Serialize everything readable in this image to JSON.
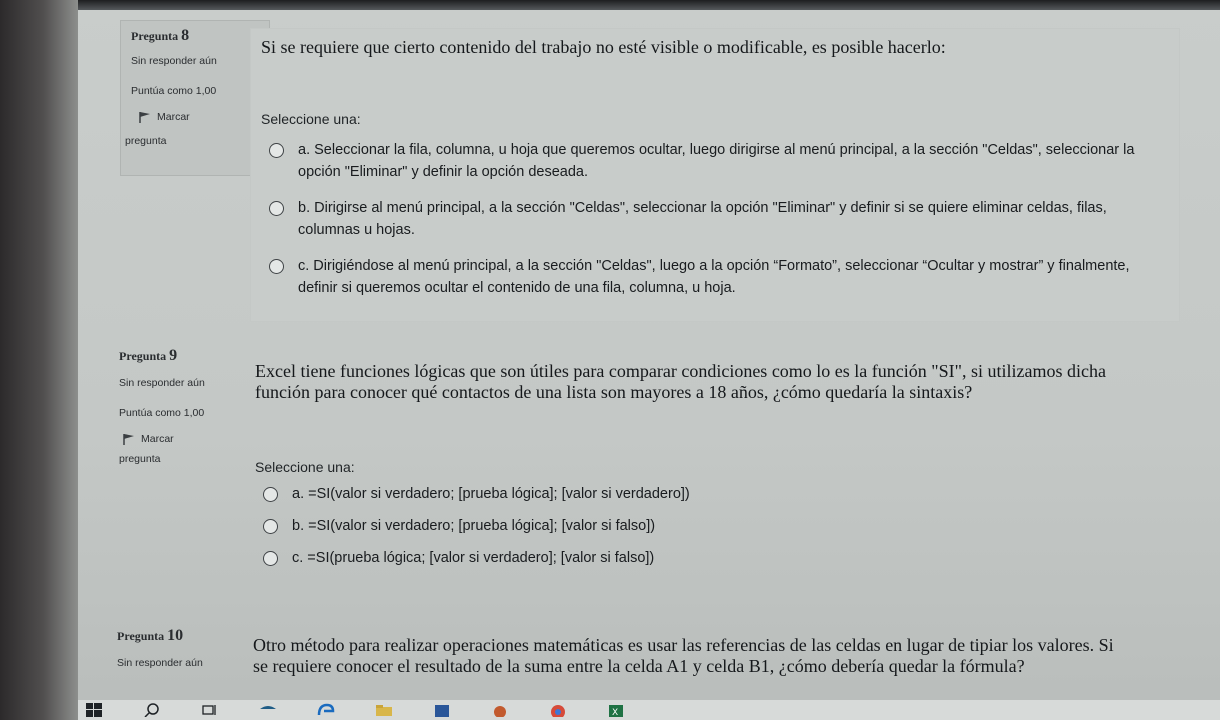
{
  "prompt_label": "Seleccione una:",
  "questions": [
    {
      "number_prefix": "Pregunta",
      "number": "8",
      "status": "Sin responder aún",
      "score": "Puntúa como 1,00",
      "flag_label": "Marcar",
      "flag_label_2": "pregunta",
      "text": "Si se requiere que cierto contenido del trabajo no esté visible o modificable, es posible hacerlo:",
      "options": [
        "a. Seleccionar la fila, columna, u hoja que queremos ocultar, luego dirigirse al menú principal, a la sección \"Celdas\", seleccionar la opción \"Eliminar\" y definir la opción deseada.",
        "b. Dirigirse al menú principal, a la sección \"Celdas\", seleccionar la opción \"Eliminar\" y definir si se quiere eliminar celdas, filas, columnas u hojas.",
        "c. Dirigiéndose al menú principal, a la sección \"Celdas\", luego a la opción “Formato”, seleccionar “Ocultar y mostrar” y finalmente, definir si queremos ocultar el contenido de una fila, columna, u hoja."
      ]
    },
    {
      "number_prefix": "Pregunta",
      "number": "9",
      "status": "Sin responder aún",
      "score": "Puntúa como 1,00",
      "flag_label": "Marcar",
      "flag_label_2": "pregunta",
      "text": "Excel tiene funciones lógicas que son útiles para comparar condiciones como lo es la función \"SI\", si utilizamos dicha función para conocer qué contactos de una lista son mayores a 18 años, ¿cómo quedaría la sintaxis?",
      "options": [
        "a. =SI(valor si verdadero; [prueba lógica]; [valor si verdadero])",
        "b. =SI(valor si verdadero; [prueba lógica]; [valor si falso])",
        "c. =SI(prueba lógica; [valor si verdadero]; [valor si falso])"
      ]
    },
    {
      "number_prefix": "Pregunta",
      "number": "10",
      "status": "Sin responder aún",
      "text": "Otro método para realizar operaciones matemáticas es usar las referencias de las celdas en lugar de tipiar los valores. Si se requiere conocer el resultado de la suma entre la celda A1 y celda B1, ¿cómo debería quedar la fórmula?"
    }
  ],
  "taskbar_icons": [
    "windows-icon",
    "search-icon",
    "task-view-icon",
    "store-icon",
    "edge-icon",
    "file-explorer-icon",
    "word-icon",
    "media-icon",
    "chrome-icon",
    "excel-icon"
  ],
  "colors": {
    "page_bg": "#c8ccca",
    "info_bg": "#c0c4c2",
    "text": "#15181b",
    "radio_border": "#3f4346"
  }
}
